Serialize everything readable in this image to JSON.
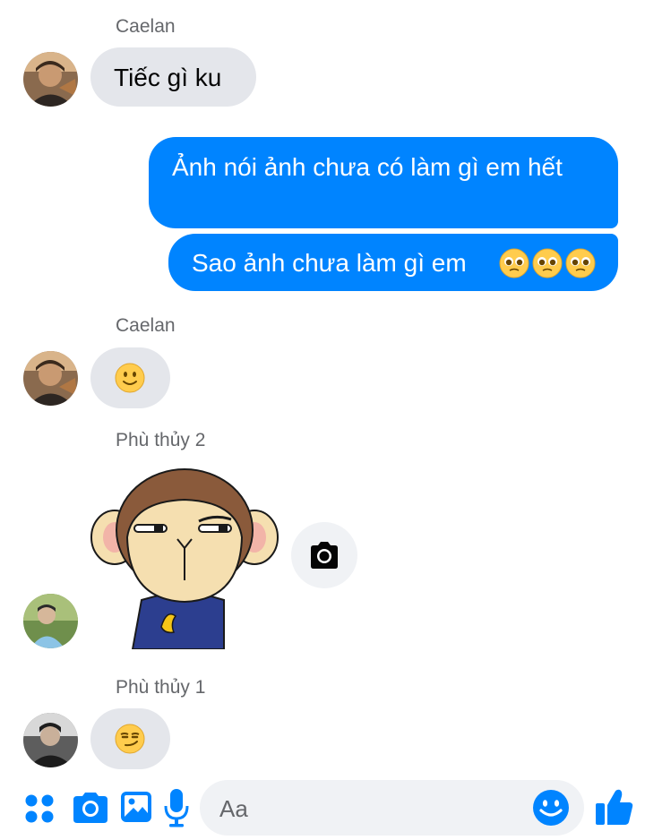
{
  "thread": {
    "groups": [
      {
        "sender": "Caelan",
        "text": "Tiếc gì ku"
      },
      {
        "sender": "Caelan",
        "emoji": "slightly-smiling-face"
      },
      {
        "sender": "Phù thủy 2",
        "sticker": "monkey-sticker"
      },
      {
        "sender": "Phù thủy 1",
        "emoji": "smirking-face"
      }
    ],
    "outgoing": [
      "Ảnh nói ảnh chưa có làm gì em hết",
      "Sao ảnh chưa làm gì em"
    ],
    "outgoing_emoji": [
      "pleading-face",
      "pleading-face",
      "pleading-face"
    ]
  },
  "composer": {
    "placeholder": "Aa",
    "icons": [
      "menu-icon",
      "camera-icon",
      "gallery-icon",
      "mic-icon",
      "emoji-icon",
      "like-icon"
    ]
  },
  "colors": {
    "accent": "#0084ff",
    "incoming_bubble": "#e4e6eb",
    "composer_bg": "#f0f2f5",
    "secondary_text": "#65676b"
  }
}
